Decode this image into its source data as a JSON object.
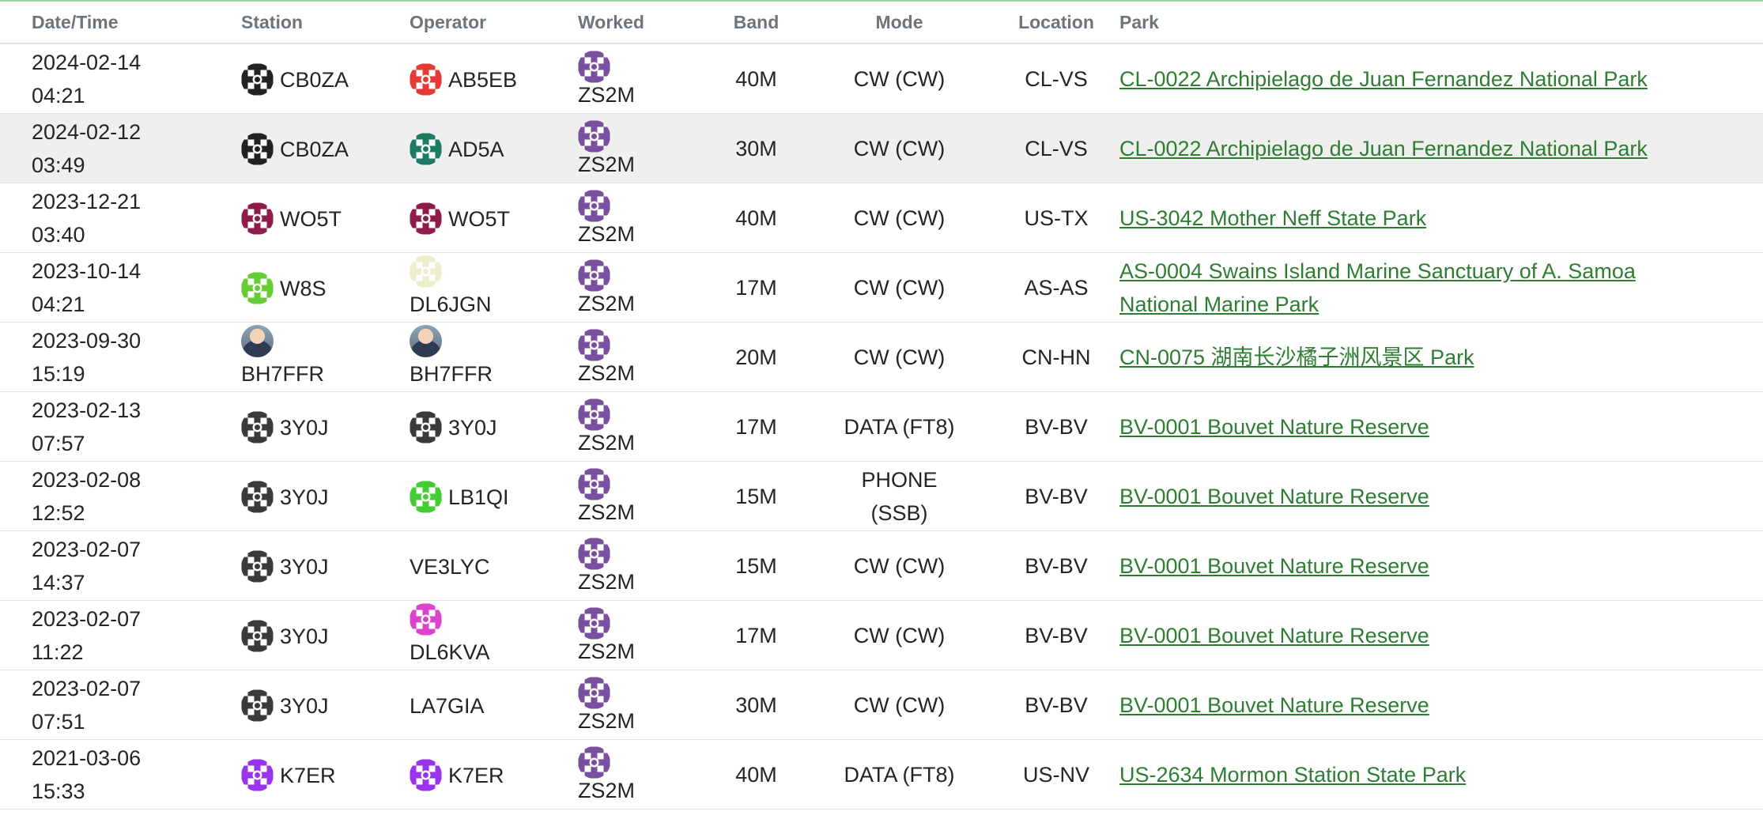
{
  "columns": [
    "Date/Time",
    "Station",
    "Operator",
    "Worked",
    "Band",
    "Mode",
    "Location",
    "Park"
  ],
  "colors": {
    "link": "#2e7d32",
    "header_text": "#6c757d",
    "top_rule": "#4caf50"
  },
  "rows": [
    {
      "date": "2024-02-14",
      "time": "04:21",
      "station": "CB0ZA",
      "station_icon": "identicon-black",
      "operator": "AB5EB",
      "operator_icon": "identicon-red",
      "worked": "ZS2M",
      "band": "40M",
      "mode": "CW (CW)",
      "mode_wrap": false,
      "location": "CL-VS",
      "park_line1": "CL-0022 Archipielago de Juan Fernandez National Park",
      "park_line2": "",
      "shaded": false
    },
    {
      "date": "2024-02-12",
      "time": "03:49",
      "station": "CB0ZA",
      "station_icon": "identicon-black",
      "operator": "AD5A",
      "operator_icon": "identicon-teal",
      "worked": "ZS2M",
      "band": "30M",
      "mode": "CW (CW)",
      "mode_wrap": false,
      "location": "CL-VS",
      "park_line1": "CL-0022 Archipielago de Juan Fernandez National Park",
      "park_line2": "",
      "shaded": true
    },
    {
      "date": "2023-12-21",
      "time": "03:40",
      "station": "WO5T",
      "station_icon": "identicon-maroon",
      "operator": "WO5T",
      "operator_icon": "identicon-maroon",
      "worked": "ZS2M",
      "band": "40M",
      "mode": "CW (CW)",
      "mode_wrap": false,
      "location": "US-TX",
      "park_line1": "US-3042 Mother Neff State Park",
      "park_line2": "",
      "shaded": false
    },
    {
      "date": "2023-10-14",
      "time": "04:21",
      "station": "W8S",
      "station_icon": "identicon-lime",
      "operator": "DL6JGN",
      "operator_icon": "identicon-cream",
      "operator_below": true,
      "worked": "ZS2M",
      "band": "17M",
      "mode": "CW (CW)",
      "mode_wrap": false,
      "location": "AS-AS",
      "park_line1": "AS-0004 Swains Island Marine Sanctuary of A. Samoa",
      "park_line2": "National Marine Park",
      "shaded": false
    },
    {
      "date": "2023-09-30",
      "time": "15:19",
      "station": "BH7FFR",
      "station_icon": "photo",
      "station_below": true,
      "operator": "BH7FFR",
      "operator_icon": "photo",
      "operator_below": true,
      "worked": "ZS2M",
      "band": "20M",
      "mode": "CW (CW)",
      "mode_wrap": false,
      "location": "CN-HN",
      "park_line1": "CN-0075 湖南长沙橘子洲风景区 Park",
      "park_line2": "",
      "shaded": false
    },
    {
      "date": "2023-02-13",
      "time": "07:57",
      "station": "3Y0J",
      "station_icon": "identicon-dark",
      "operator": "3Y0J",
      "operator_icon": "identicon-dark",
      "worked": "ZS2M",
      "band": "17M",
      "mode": "DATA (FT8)",
      "mode_wrap": false,
      "location": "BV-BV",
      "park_line1": "BV-0001 Bouvet Nature Reserve",
      "park_line2": "",
      "shaded": false
    },
    {
      "date": "2023-02-08",
      "time": "12:52",
      "station": "3Y0J",
      "station_icon": "identicon-dark",
      "operator": "LB1QI",
      "operator_icon": "identicon-green",
      "worked": "ZS2M",
      "band": "15M",
      "mode": "PHONE",
      "mode2": "(SSB)",
      "mode_wrap": true,
      "location": "BV-BV",
      "park_line1": "BV-0001 Bouvet Nature Reserve",
      "park_line2": "",
      "shaded": false
    },
    {
      "date": "2023-02-07",
      "time": "14:37",
      "station": "3Y0J",
      "station_icon": "identicon-dark",
      "operator": "VE3LYC",
      "operator_icon": "",
      "worked": "ZS2M",
      "band": "15M",
      "mode": "CW (CW)",
      "mode_wrap": false,
      "location": "BV-BV",
      "park_line1": "BV-0001 Bouvet Nature Reserve",
      "park_line2": "",
      "shaded": false
    },
    {
      "date": "2023-02-07",
      "time": "11:22",
      "station": "3Y0J",
      "station_icon": "identicon-dark",
      "operator": "DL6KVA",
      "operator_icon": "identicon-pink",
      "operator_below": true,
      "worked": "ZS2M",
      "band": "17M",
      "mode": "CW (CW)",
      "mode_wrap": false,
      "location": "BV-BV",
      "park_line1": "BV-0001 Bouvet Nature Reserve",
      "park_line2": "",
      "shaded": false
    },
    {
      "date": "2023-02-07",
      "time": "07:51",
      "station": "3Y0J",
      "station_icon": "identicon-dark",
      "operator": "LA7GIA",
      "operator_icon": "",
      "worked": "ZS2M",
      "band": "30M",
      "mode": "CW (CW)",
      "mode_wrap": false,
      "location": "BV-BV",
      "park_line1": "BV-0001 Bouvet Nature Reserve",
      "park_line2": "",
      "shaded": false
    },
    {
      "date": "2021-03-06",
      "time": "15:33",
      "station": "K7ER",
      "station_icon": "identicon-violet",
      "operator": "K7ER",
      "operator_icon": "identicon-violet",
      "worked": "ZS2M",
      "band": "40M",
      "mode": "DATA (FT8)",
      "mode_wrap": false,
      "location": "US-NV",
      "park_line1": "US-2634 Mormon Station State Park",
      "park_line2": "",
      "shaded": false
    }
  ],
  "identicon_colors": {
    "identicon-black": "#222222",
    "identicon-red": "#e53935",
    "identicon-teal": "#1e7b63",
    "identicon-maroon": "#8e1b4a",
    "identicon-lime": "#66cc33",
    "identicon-cream": "#eeeecc",
    "identicon-dark": "#3a3a3a",
    "identicon-green": "#44cc33",
    "identicon-pink": "#dd44cc",
    "identicon-violet": "#9933ee",
    "worked": "#7b4fa0"
  }
}
